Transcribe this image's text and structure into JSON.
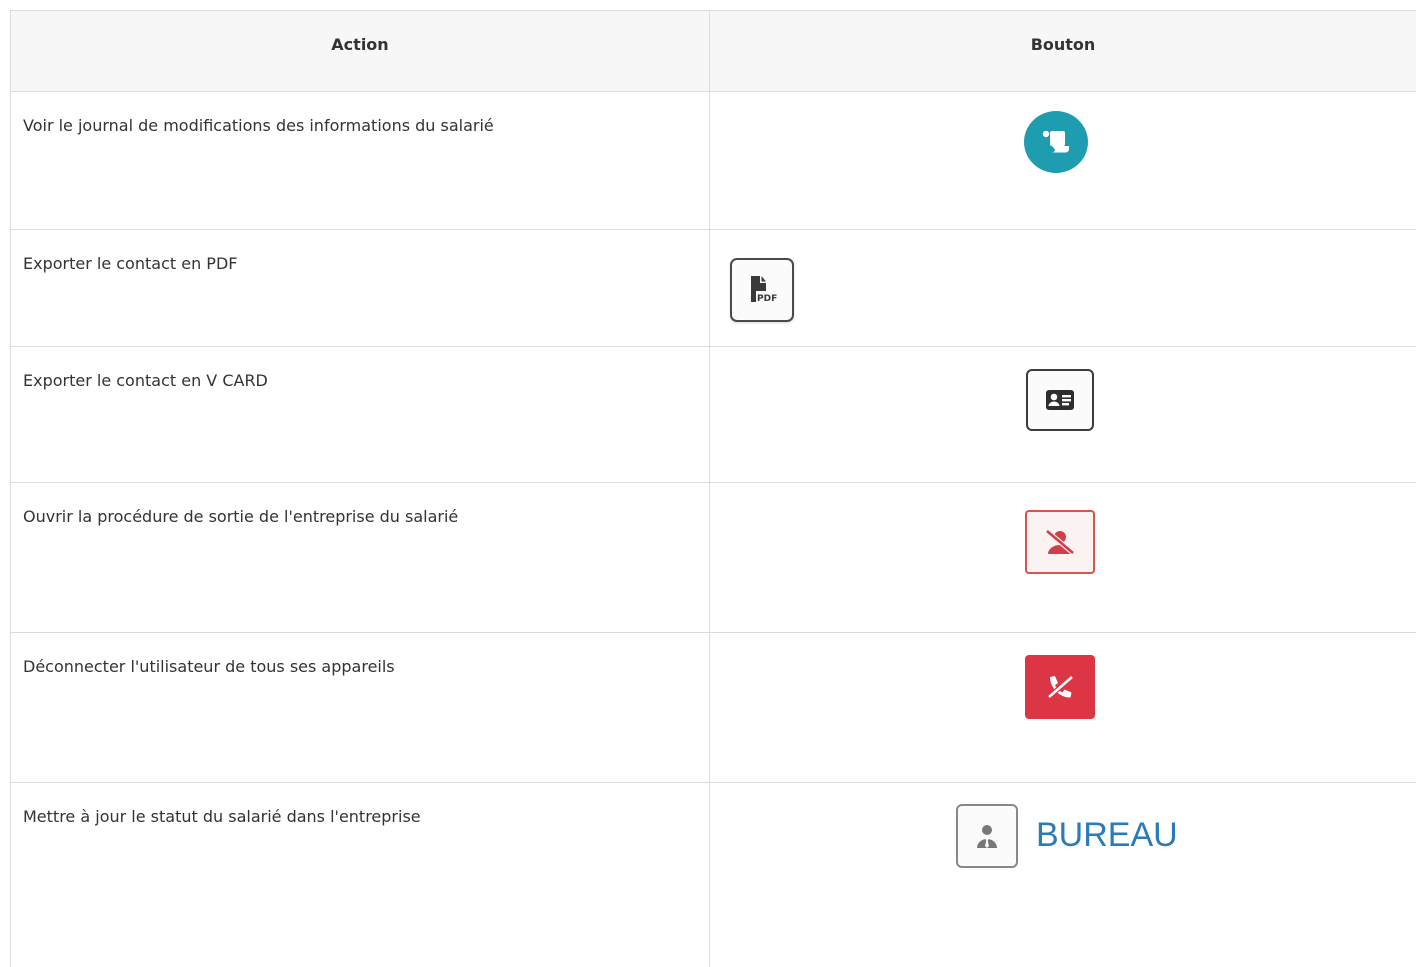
{
  "table": {
    "headers": {
      "action": "Action",
      "button": "Bouton"
    },
    "rows": [
      {
        "action": "Voir le journal de modifications des informations du salarié",
        "icon": "scroll-icon",
        "button_style": "teal-circle"
      },
      {
        "action": "Exporter le contact en PDF",
        "icon": "pdf-file-icon",
        "icon_text": "PDF",
        "button_style": "outlined-dark"
      },
      {
        "action": "Exporter le contact en V CARD",
        "icon": "id-card-icon",
        "button_style": "outlined-dark"
      },
      {
        "action": "Ouvrir la procédure de sortie de l'entreprise du salarié",
        "icon": "user-slash-icon",
        "button_style": "outlined-red"
      },
      {
        "action": "Déconnecter l'utilisateur de tous ses appareils",
        "icon": "phone-slash-icon",
        "button_style": "filled-red"
      },
      {
        "action": "Mettre à jour le statut du salarié dans l'entreprise",
        "icon": "user-tie-icon",
        "status_label": "BUREAU",
        "button_style": "outlined-grey"
      }
    ]
  },
  "colors": {
    "teal": "#1f9db0",
    "red": "#dc3545",
    "red_outline": "#d9534f",
    "status_blue": "#2b7bb9",
    "border": "#dcdcdc",
    "header_bg": "#f7f7f7"
  }
}
